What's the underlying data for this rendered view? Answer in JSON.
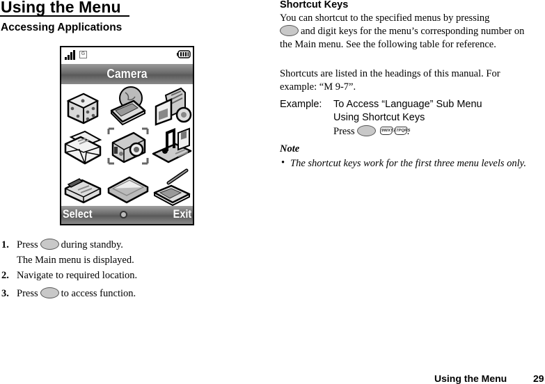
{
  "page": {
    "title": "Using the Menu",
    "section_heading": "Accessing Applications"
  },
  "phone_screen": {
    "status_icons": [
      "signal-strength-icon",
      "gprs-icon",
      "battery-icon"
    ],
    "gprs_letter": "G",
    "menu_title": "Camera",
    "menu_items": [
      {
        "icon": "games-dice-icon"
      },
      {
        "icon": "browser-globe-phone-icon"
      },
      {
        "icon": "organizer-camcorder-icon"
      },
      {
        "icon": "messages-envelope-icon"
      },
      {
        "icon": "camera-icon",
        "selected": true
      },
      {
        "icon": "media-player-music-icon"
      },
      {
        "icon": "settings-fax-icon"
      },
      {
        "icon": "my-items-folder-icon"
      },
      {
        "icon": "tools-phone-pen-icon"
      }
    ],
    "left_softkey": "Select",
    "right_softkey": "Exit"
  },
  "steps": [
    {
      "number": "1.",
      "before": "Press",
      "after": "during standby.",
      "sub": "The Main menu is displayed."
    },
    {
      "number": "2.",
      "text": "Navigate to required location."
    },
    {
      "number": "3.",
      "before": "Press",
      "after": "to access function."
    }
  ],
  "shortcut": {
    "heading": "Shortcut Keys",
    "para1_after_key": "You can shortcut to the specified menus by pressing",
    "para1_rest": "and digit keys for the menu’s corresponding number on the Main menu. See the following table for reference.",
    "para2": "Shortcuts are listed in the headings of this manual. For example: “M 9-7”.",
    "example_label": "Example:",
    "example_line1": "To Access “Language” Sub Menu",
    "example_line2": "Using Shortcut Keys",
    "example_press": "Press",
    "digit_keys": [
      {
        "digit": "9",
        "label": "9WXYZ"
      },
      {
        "digit": "7",
        "label": "7PQRS"
      }
    ],
    "example_end": "."
  },
  "note": {
    "heading": "Note",
    "bullet": "•",
    "text": "The shortcut keys work for the first three menu levels only."
  },
  "footer": {
    "title": "Using the Menu",
    "page_number": "29"
  }
}
